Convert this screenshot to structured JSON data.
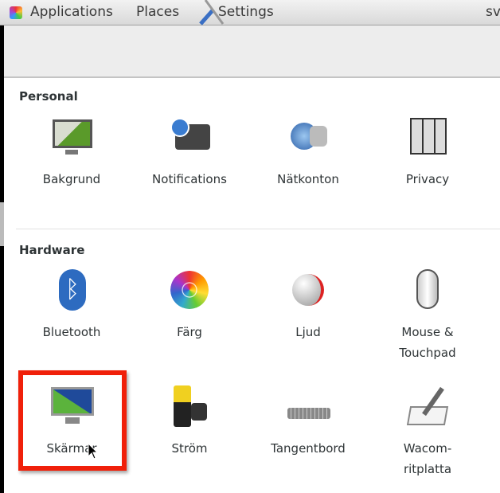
{
  "topbar": {
    "applications": "Applications",
    "places": "Places",
    "settings": "Settings",
    "right_text": "sv"
  },
  "sections": {
    "personal": "Personal",
    "hardware": "Hardware"
  },
  "personal": [
    {
      "label": "Bakgrund"
    },
    {
      "label": "Notifications"
    },
    {
      "label": "Nätkonton"
    },
    {
      "label": "Privacy"
    }
  ],
  "hardware": [
    {
      "label": "Bluetooth"
    },
    {
      "label": "Färg"
    },
    {
      "label": "Ljud"
    },
    {
      "label": "Mouse &\nTouchpad"
    },
    {
      "label": "Skärmar"
    },
    {
      "label": "Ström"
    },
    {
      "label": "Tangentbord"
    },
    {
      "label": "Wacom-\nritplatta"
    }
  ],
  "highlight_color": "#f0200a"
}
